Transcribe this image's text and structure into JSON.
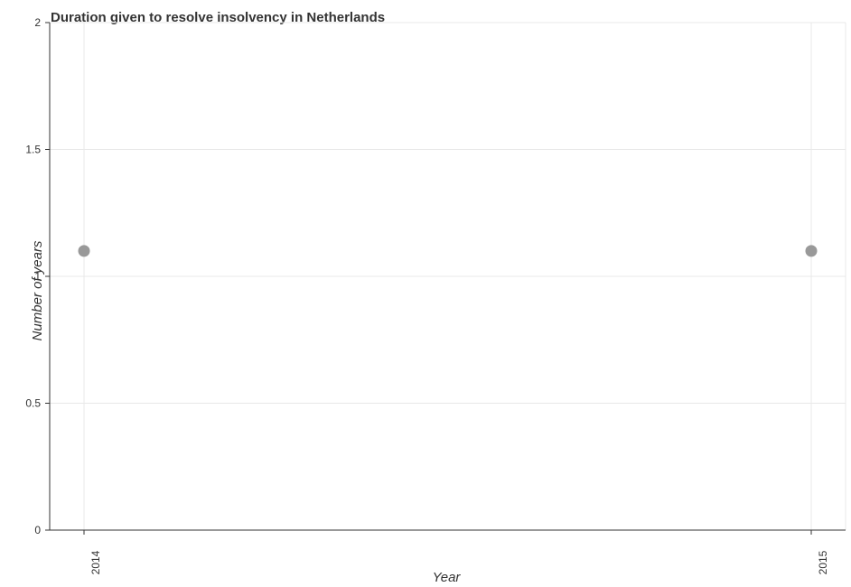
{
  "chart_data": {
    "type": "scatter",
    "title": "Duration given to resolve insolvency in Netherlands",
    "xlabel": "Year",
    "ylabel": "Number of years",
    "categories": [
      "2014",
      "2015"
    ],
    "series": [
      {
        "values": [
          1.1,
          1.1
        ],
        "color": "#999999"
      }
    ],
    "ylim": [
      0,
      2
    ],
    "yticks": [
      0,
      0.5,
      1,
      1.5,
      2
    ],
    "ytick_labels": [
      "0",
      "0.5",
      "1",
      "1.5",
      "2"
    ],
    "grid": true,
    "legend": "none"
  }
}
